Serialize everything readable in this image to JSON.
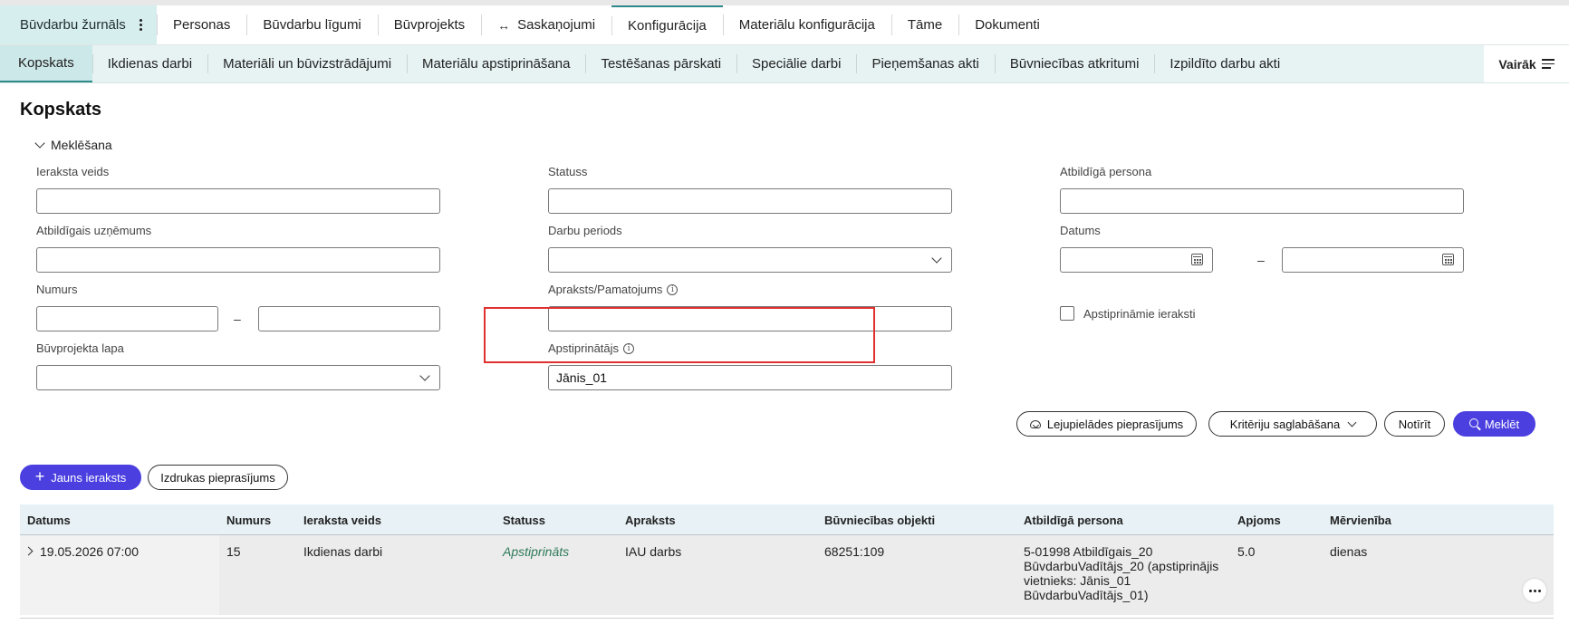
{
  "nav_primary": {
    "brand": "Būvdarbu žurnāls",
    "items": [
      {
        "label": "Personas"
      },
      {
        "label": "Būvdarbu līgumi"
      },
      {
        "label": "Būvprojekts"
      },
      {
        "label": "Saskaņojumi"
      },
      {
        "label": "Konfigurācija"
      },
      {
        "label": "Materiālu konfigurācija"
      },
      {
        "label": "Tāme"
      },
      {
        "label": "Dokumenti"
      }
    ],
    "active": "Konfigurācija"
  },
  "nav_secondary": {
    "items": [
      {
        "label": "Kopskats"
      },
      {
        "label": "Ikdienas darbi"
      },
      {
        "label": "Materiāli un būvizstrādājumi"
      },
      {
        "label": "Materiālu apstiprināšana"
      },
      {
        "label": "Testēšanas pārskati"
      },
      {
        "label": "Speciālie darbi"
      },
      {
        "label": "Pieņemšanas akti"
      },
      {
        "label": "Būvniecības atkritumi"
      },
      {
        "label": "Izpildīto darbu akti"
      }
    ],
    "active": "Kopskats",
    "more_label": "Vairāk"
  },
  "page": {
    "title": "Kopskats",
    "search_toggle": "Meklēšana"
  },
  "filters": {
    "record_type": {
      "label": "Ieraksta veids",
      "value": ""
    },
    "status": {
      "label": "Statuss",
      "value": ""
    },
    "responsible_person": {
      "label": "Atbildīgā persona",
      "value": ""
    },
    "responsible_company": {
      "label": "Atbildīgais uzņēmums",
      "value": ""
    },
    "work_period": {
      "label": "Darbu periods",
      "value": ""
    },
    "date": {
      "label": "Datums",
      "from": "",
      "to": ""
    },
    "number": {
      "label": "Numurs",
      "from": "",
      "to": ""
    },
    "description": {
      "label": "Apraksts/Pamatojums",
      "value": ""
    },
    "approvable_records": {
      "label": "Apstiprināmie ieraksti",
      "checked": false
    },
    "project_page": {
      "label": "Būvprojekta lapa",
      "value": ""
    },
    "approver": {
      "label": "Apstiprinātājs",
      "value": "Jānis_01"
    },
    "range_separator": "–"
  },
  "actions": {
    "download_request": "Lejupielādes pieprasījums",
    "save_criteria": "Kritēriju saglabāšana",
    "clear": "Notīrīt",
    "search": "Meklēt",
    "new_record": "Jauns ieraksts",
    "print_request": "Izdrukas pieprasījums"
  },
  "table": {
    "columns": [
      "Datums",
      "Numurs",
      "Ieraksta veids",
      "Statuss",
      "Apraksts",
      "Būvniecības objekti",
      "Atbildīgā persona",
      "Apjoms",
      "Mērvienība"
    ],
    "rows": [
      {
        "date": "19.05.2026 07:00",
        "number": "15",
        "record_type": "Ikdienas darbi",
        "status": "Apstiprināts",
        "description": "IAU darbs",
        "objects": "68251:109",
        "person_lines": [
          "5-01998 Atbildīgais_20",
          "BūvdarbuVadītājs_20 (apstiprinājis",
          "vietnieks: Jānis_01",
          "BūvdarbuVadītājs_01)"
        ],
        "volume": "5.0",
        "unit": "dienas"
      }
    ]
  },
  "colors": {
    "accent_teal": "#2e8a8a",
    "primary_button": "#4b3fe0",
    "highlight_border": "#e03030",
    "status_approved": "#2e7a5a"
  }
}
